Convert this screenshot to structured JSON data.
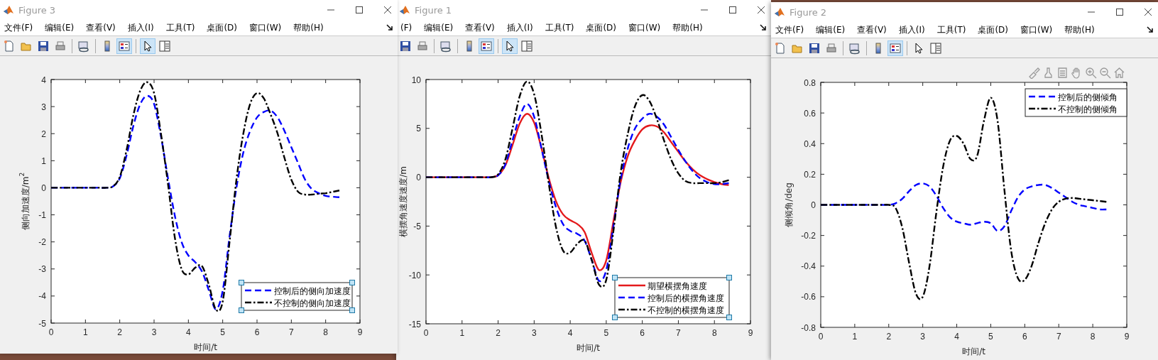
{
  "figures": [
    {
      "title": "Figure 3",
      "menus": [
        "文件(F)",
        "编辑(E)",
        "查看(V)",
        "插入(I)",
        "工具(T)",
        "桌面(D)",
        "窗口(W)",
        "帮助(H)"
      ],
      "tools": [
        {
          "kind": "new",
          "selected": false
        },
        {
          "kind": "open",
          "selected": false
        },
        {
          "kind": "save",
          "selected": false
        },
        {
          "kind": "print",
          "selected": false
        },
        {
          "kind": "sep"
        },
        {
          "kind": "link",
          "selected": false
        },
        {
          "kind": "sep"
        },
        {
          "kind": "colorbar",
          "selected": false
        },
        {
          "kind": "legend",
          "selected": true
        },
        {
          "kind": "sep"
        },
        {
          "kind": "pointer",
          "selected": true
        },
        {
          "kind": "inspector",
          "selected": false
        }
      ],
      "axes_toolbar": false,
      "legend_selected": true,
      "chart_data": {
        "type": "line",
        "legend": true,
        "xlabel": "时间/t",
        "ylabel": "侧向加速度/m$^{2}$",
        "xlim": [
          0,
          9
        ],
        "ylim": [
          -5,
          4
        ],
        "xticks": [
          0,
          1,
          2,
          3,
          4,
          5,
          6,
          7,
          8,
          9
        ],
        "yticks": [
          -5,
          -4,
          -3,
          -2,
          -1,
          0,
          1,
          2,
          3,
          4
        ],
        "x": [
          0,
          0.2,
          0.4,
          0.6,
          0.8,
          1,
          1.2,
          1.4,
          1.6,
          1.8,
          2,
          2.2,
          2.4,
          2.6,
          2.8,
          3,
          3.2,
          3.4,
          3.6,
          3.8,
          4,
          4.2,
          4.4,
          4.6,
          4.8,
          5,
          5.2,
          5.4,
          5.6,
          5.8,
          6,
          6.2,
          6.4,
          6.6,
          6.8,
          7,
          7.2,
          7.4,
          7.6,
          7.8,
          8,
          8.2,
          8.4
        ],
        "series": [
          {
            "name": "控制后的侧向加速度",
            "color": "#0000ff",
            "line_style": "dashed",
            "values": [
              0,
              0,
              0,
              0,
              0,
              0,
              0,
              0,
              0,
              0.05,
              0.35,
              1.2,
              2.3,
              3.1,
              3.4,
              3.1,
              1.9,
              0.4,
              -1.0,
              -2.0,
              -2.5,
              -2.75,
              -3.1,
              -3.8,
              -4.5,
              -3.8,
              -1.8,
              0.0,
              1.3,
              2.1,
              2.6,
              2.8,
              2.85,
              2.6,
              2.1,
              1.5,
              0.9,
              0.3,
              -0.05,
              -0.2,
              -0.3,
              -0.33,
              -0.35
            ]
          },
          {
            "name": "不控制的侧向加速度",
            "color": "#000000",
            "line_style": "dashdot",
            "values": [
              0,
              0,
              0,
              0,
              0,
              0,
              0,
              0,
              0,
              0.05,
              0.4,
              1.4,
              2.7,
              3.6,
              3.9,
              3.5,
              2.0,
              0.2,
              -1.8,
              -3.0,
              -3.2,
              -2.95,
              -2.9,
              -3.6,
              -4.5,
              -4.2,
              -2.0,
              0.3,
              2.0,
              3.1,
              3.5,
              3.3,
              2.7,
              2.0,
              1.1,
              0.3,
              -0.15,
              -0.25,
              -0.25,
              -0.22,
              -0.2,
              -0.15,
              -0.1
            ]
          }
        ]
      }
    },
    {
      "title": "Figure 1",
      "menus": [
        "(F)",
        "编辑(E)",
        "查看(V)",
        "插入(I)",
        "工具(T)",
        "桌面(D)",
        "窗口(W)",
        "帮助(H)"
      ],
      "tools": [
        {
          "kind": "save",
          "selected": false
        },
        {
          "kind": "print",
          "selected": false
        },
        {
          "kind": "sep"
        },
        {
          "kind": "link",
          "selected": false
        },
        {
          "kind": "sep"
        },
        {
          "kind": "colorbar",
          "selected": false
        },
        {
          "kind": "legend",
          "selected": true
        },
        {
          "kind": "sep"
        },
        {
          "kind": "pointer",
          "selected": true
        },
        {
          "kind": "inspector",
          "selected": false
        }
      ],
      "axes_toolbar": false,
      "legend_selected": true,
      "chart_data": {
        "type": "line",
        "legend": true,
        "xlabel": "时间/t",
        "ylabel": "横摆角速度速度/m",
        "xlim": [
          0,
          9
        ],
        "ylim": [
          -15,
          10
        ],
        "xticks": [
          0,
          1,
          2,
          3,
          4,
          5,
          6,
          7,
          8,
          9
        ],
        "yticks": [
          -15,
          -10,
          -5,
          0,
          5,
          10
        ],
        "x": [
          0,
          0.2,
          0.4,
          0.6,
          0.8,
          1,
          1.2,
          1.4,
          1.6,
          1.8,
          2,
          2.2,
          2.4,
          2.6,
          2.8,
          3,
          3.2,
          3.4,
          3.6,
          3.8,
          4,
          4.2,
          4.4,
          4.6,
          4.8,
          5,
          5.2,
          5.4,
          5.6,
          5.8,
          6,
          6.2,
          6.4,
          6.6,
          6.8,
          7,
          7.2,
          7.4,
          7.6,
          7.8,
          8,
          8.2,
          8.4
        ],
        "series": [
          {
            "name": "期望横摆角速度",
            "color": "#e41a1c",
            "line_style": "solid",
            "values": [
              0,
              0,
              0,
              0,
              0,
              0,
              0,
              0,
              0,
              0,
              0.2,
              1.2,
              3.3,
              5.5,
              6.5,
              5.6,
              3.0,
              0.0,
              -2.4,
              -3.8,
              -4.4,
              -4.8,
              -5.6,
              -7.8,
              -9.5,
              -8.5,
              -4.5,
              -0.5,
              2.2,
              3.8,
              4.9,
              5.3,
              5.2,
              4.6,
              3.6,
              2.6,
              1.6,
              0.8,
              0.2,
              -0.2,
              -0.5,
              -0.7,
              -0.8
            ]
          },
          {
            "name": "控制后的横摆角速度",
            "color": "#0000ff",
            "line_style": "dashed",
            "values": [
              0,
              0,
              0,
              0,
              0,
              0,
              0,
              0,
              0,
              0,
              0.2,
              1.3,
              3.8,
              6.2,
              7.5,
              6.2,
              3.0,
              -0.3,
              -3.0,
              -4.8,
              -5.5,
              -5.8,
              -6.5,
              -8.5,
              -10.6,
              -9.5,
              -5.0,
              -0.2,
              3.0,
              5.0,
              6.0,
              6.5,
              6.2,
              5.4,
              4.1,
              2.8,
              1.6,
              0.6,
              -0.1,
              -0.5,
              -0.7,
              -0.7,
              -0.6
            ]
          },
          {
            "name": "不控制的横摆角速度",
            "color": "#000000",
            "line_style": "dashdot",
            "values": [
              0,
              0,
              0,
              0,
              0,
              0,
              0,
              0,
              0,
              0,
              0.3,
              1.8,
              5.0,
              8.3,
              9.8,
              8.5,
              4.5,
              -0.5,
              -5.0,
              -7.5,
              -7.7,
              -6.8,
              -6.5,
              -8.5,
              -11.0,
              -10.5,
              -5.5,
              0.5,
              4.5,
              7.3,
              8.4,
              7.8,
              6.0,
              3.8,
              1.8,
              0.4,
              -0.4,
              -0.6,
              -0.6,
              -0.6,
              -0.6,
              -0.5,
              -0.3
            ]
          }
        ]
      }
    },
    {
      "title": "Figure 2",
      "menus": [
        "文件(F)",
        "编辑(E)",
        "查看(V)",
        "插入(I)",
        "工具(T)",
        "桌面(D)",
        "窗口(W)",
        "帮助(H)"
      ],
      "tools": [
        {
          "kind": "new",
          "selected": false
        },
        {
          "kind": "open",
          "selected": false
        },
        {
          "kind": "save",
          "selected": false
        },
        {
          "kind": "print",
          "selected": false
        },
        {
          "kind": "sep"
        },
        {
          "kind": "link",
          "selected": false
        },
        {
          "kind": "sep"
        },
        {
          "kind": "colorbar",
          "selected": false
        },
        {
          "kind": "legend",
          "selected": true
        },
        {
          "kind": "sep"
        },
        {
          "kind": "pointer",
          "selected": false
        },
        {
          "kind": "inspector",
          "selected": false
        }
      ],
      "axes_toolbar": true,
      "legend_selected": false,
      "chart_data": {
        "type": "line",
        "legend": true,
        "xlabel": "时间/t",
        "ylabel": "侧倾角/deg",
        "xlim": [
          0,
          9
        ],
        "ylim": [
          -0.8,
          0.8
        ],
        "xticks": [
          0,
          1,
          2,
          3,
          4,
          5,
          6,
          7,
          8,
          9
        ],
        "yticks": [
          -0.8,
          -0.6,
          -0.4,
          -0.2,
          0,
          0.2,
          0.4,
          0.6,
          0.8
        ],
        "x": [
          0,
          0.2,
          0.4,
          0.6,
          0.8,
          1,
          1.2,
          1.4,
          1.6,
          1.8,
          2,
          2.2,
          2.4,
          2.6,
          2.8,
          3,
          3.2,
          3.4,
          3.6,
          3.8,
          4,
          4.2,
          4.4,
          4.6,
          4.8,
          5,
          5.2,
          5.4,
          5.6,
          5.8,
          6,
          6.2,
          6.4,
          6.6,
          6.8,
          7,
          7.2,
          7.4,
          7.6,
          7.8,
          8,
          8.2,
          8.4
        ],
        "series": [
          {
            "name": "控制后的侧倾角",
            "color": "#0000ff",
            "line_style": "dashed",
            "values": [
              0,
              0,
              0,
              0,
              0,
              0,
              0,
              0,
              0,
              0,
              0,
              0.01,
              0.04,
              0.09,
              0.13,
              0.14,
              0.12,
              0.06,
              -0.02,
              -0.08,
              -0.11,
              -0.12,
              -0.13,
              -0.12,
              -0.11,
              -0.12,
              -0.17,
              -0.14,
              -0.04,
              0.05,
              0.1,
              0.12,
              0.13,
              0.13,
              0.11,
              0.08,
              0.05,
              0.02,
              0.0,
              -0.01,
              -0.02,
              -0.03,
              -0.03
            ]
          },
          {
            "name": "不控制的侧倾角",
            "color": "#000000",
            "line_style": "dashdot",
            "values": [
              0,
              0,
              0,
              0,
              0,
              0,
              0,
              0,
              0,
              0,
              0,
              -0.02,
              -0.15,
              -0.38,
              -0.58,
              -0.6,
              -0.4,
              -0.05,
              0.25,
              0.42,
              0.45,
              0.4,
              0.3,
              0.32,
              0.55,
              0.7,
              0.55,
              0.1,
              -0.3,
              -0.48,
              -0.49,
              -0.4,
              -0.25,
              -0.12,
              -0.03,
              0.02,
              0.04,
              0.045,
              0.04,
              0.035,
              0.03,
              0.025,
              0.02
            ]
          }
        ]
      }
    }
  ]
}
